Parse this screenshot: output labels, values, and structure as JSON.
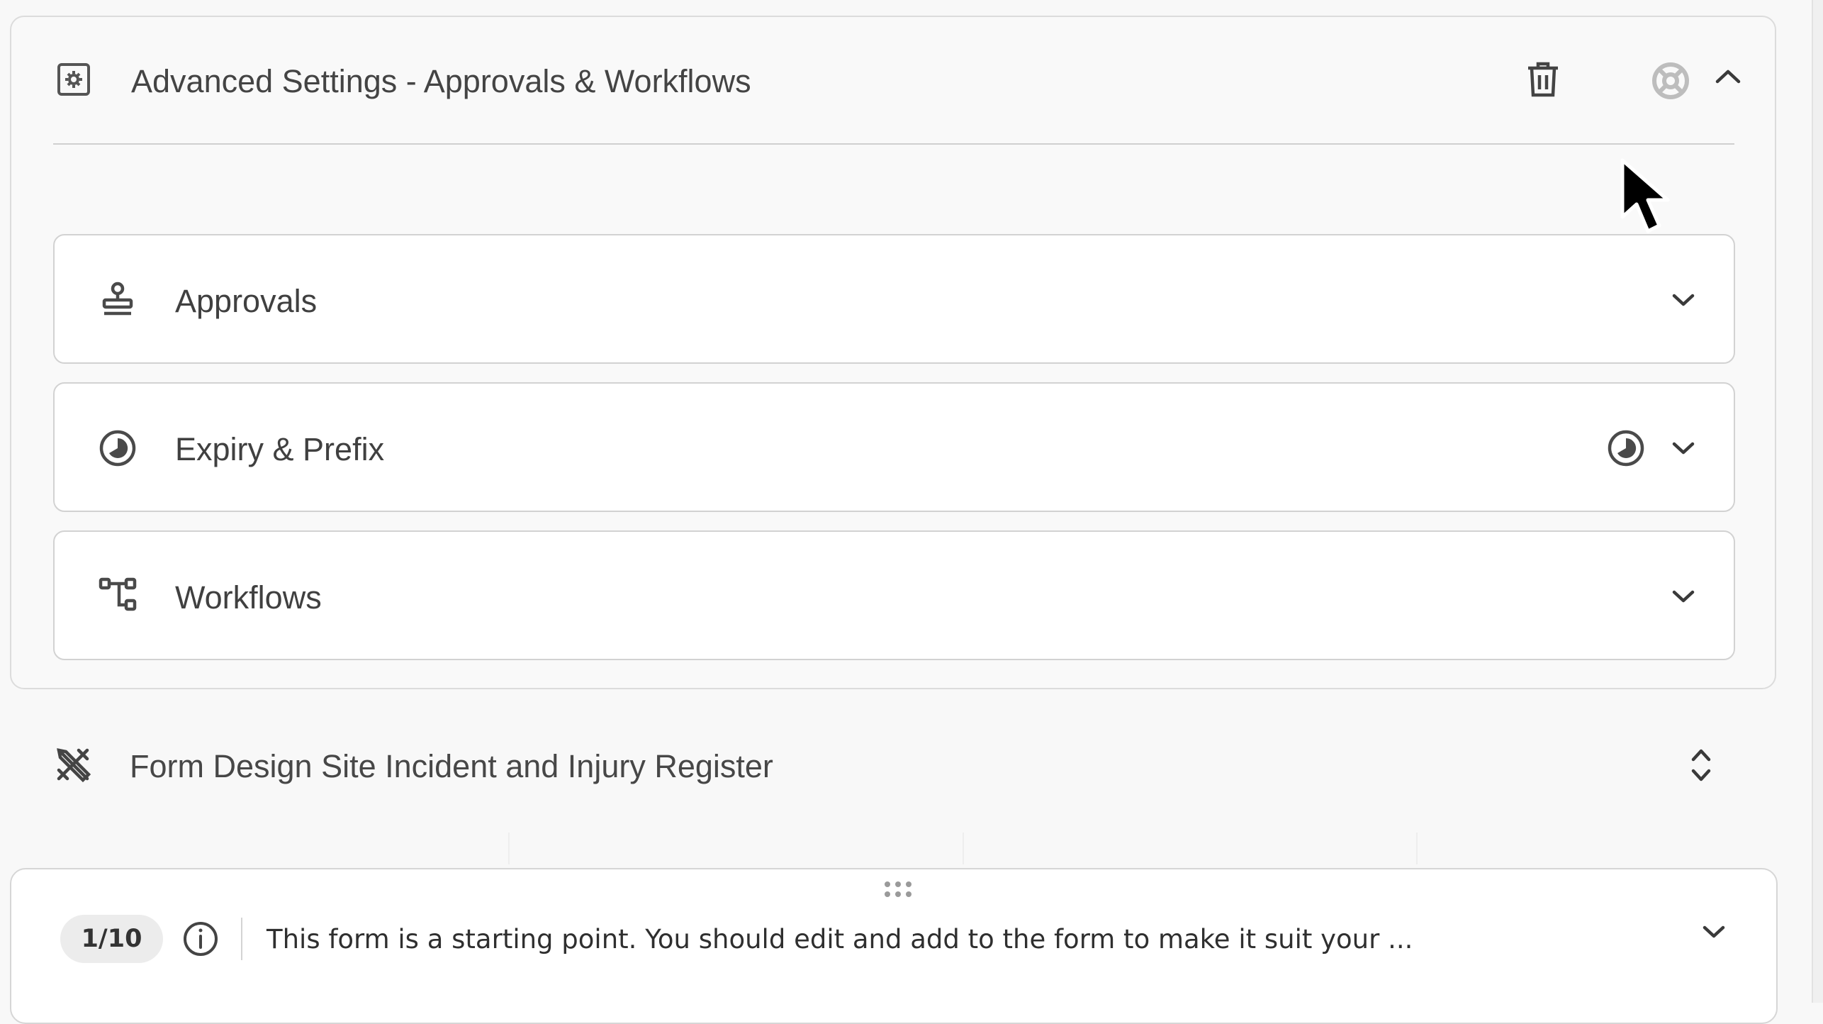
{
  "advanced_settings": {
    "title": "Advanced Settings - Approvals & Workflows",
    "icon": "settings-square-icon",
    "actions": {
      "delete_icon": "trash-icon",
      "help_icon": "lifebuoy-icon",
      "collapse_icon": "chevron-up-icon"
    },
    "sections": [
      {
        "label": "Approvals",
        "icon": "stamp-icon"
      },
      {
        "label": "Expiry & Prefix",
        "icon": "clock-half-icon"
      },
      {
        "label": "Workflows",
        "icon": "workflow-icon"
      }
    ]
  },
  "form_design": {
    "title": "Form Design Site Incident and Injury Register",
    "icon": "design-tools-icon"
  },
  "tip_bar": {
    "counter": "1/10",
    "text": "This form is a starting point. You should edit and add to the form to make it suit your ..."
  }
}
